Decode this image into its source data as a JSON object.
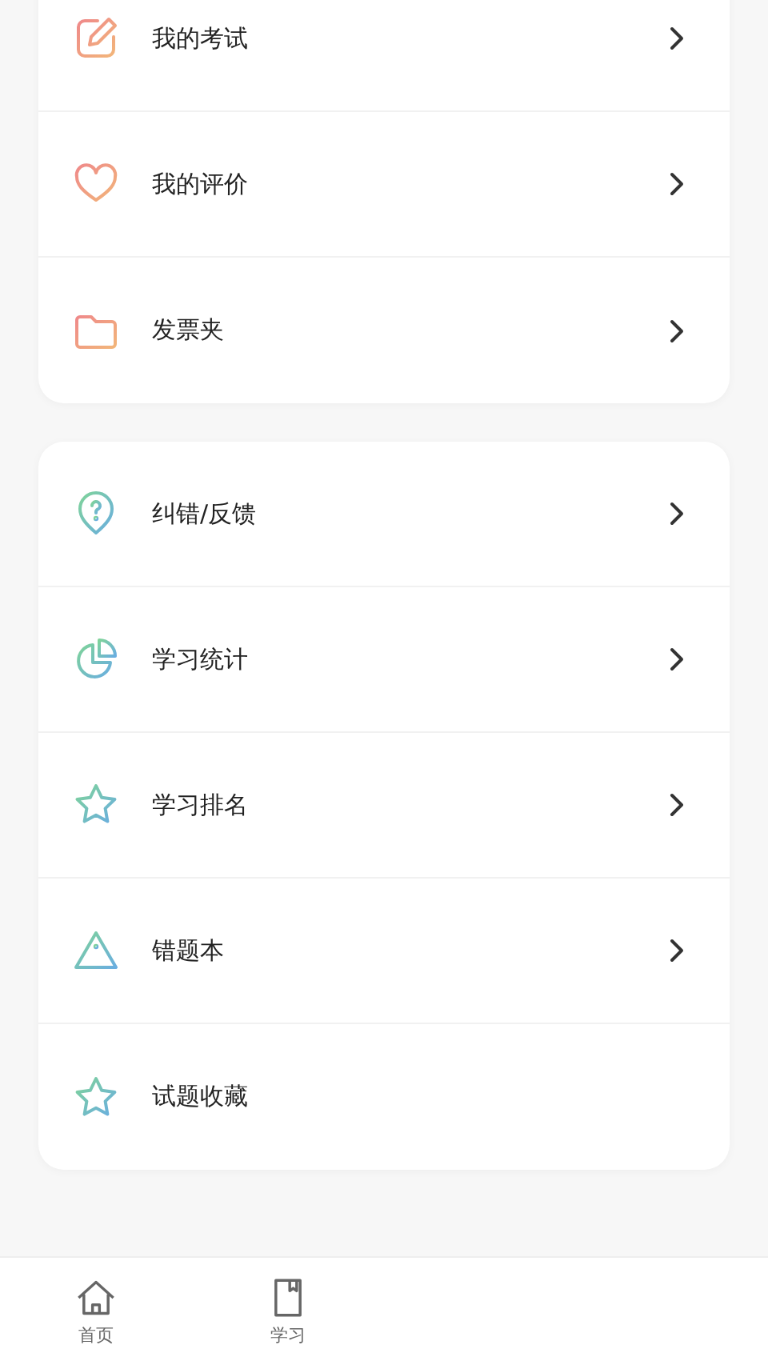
{
  "groups": [
    {
      "items": [
        {
          "label": "我的考试",
          "kind": "edit",
          "chevron": true
        },
        {
          "label": "我的评价",
          "kind": "heart",
          "chevron": true
        },
        {
          "label": "发票夹",
          "kind": "folder",
          "chevron": true
        }
      ]
    },
    {
      "items": [
        {
          "label": "纠错/反馈",
          "kind": "pin",
          "chevron": true
        },
        {
          "label": "学习统计",
          "kind": "pie",
          "chevron": true
        },
        {
          "label": "学习排名",
          "kind": "star",
          "chevron": true
        },
        {
          "label": "错题本",
          "kind": "warning",
          "chevron": true
        },
        {
          "label": "试题收藏",
          "kind": "star",
          "chevron": false
        }
      ]
    }
  ],
  "tab_bar": [
    {
      "label": "首页",
      "kind": "home"
    },
    {
      "label": "学习",
      "kind": "book"
    }
  ]
}
